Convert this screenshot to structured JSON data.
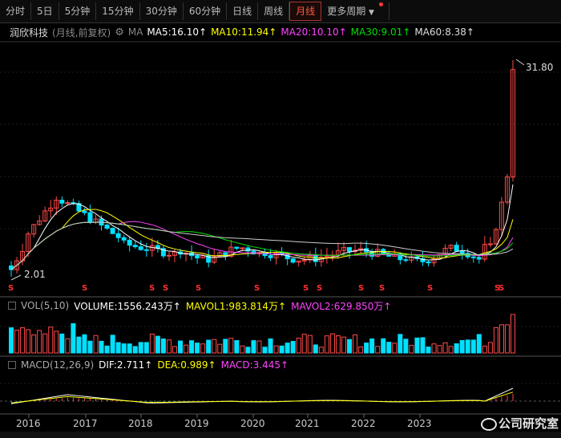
{
  "toolbar": {
    "tabs": [
      "分时",
      "5日",
      "5分钟",
      "15分钟",
      "30分钟",
      "60分钟",
      "日线",
      "周线",
      "月线",
      "更多周期"
    ],
    "active": "月线"
  },
  "info": {
    "stock_name": "润欣科技",
    "note": "(月线,前复权)",
    "ma_label": "MA",
    "ma5": "MA5:16.10↑",
    "ma10": "MA10:11.94↑",
    "ma20": "MA20:10.10↑",
    "ma30": "MA30:9.01↑",
    "ma60": "MA60:8.38↑"
  },
  "price_labels": {
    "high": "31.80",
    "low": "2.01"
  },
  "vol": {
    "title": "VOL(5,10)",
    "volume": "VOLUME:1556.243万↑",
    "mavol1": "MAVOL1:983.814万↑",
    "mavol2": "MAVOL2:629.850万↑"
  },
  "macd": {
    "title": "MACD(12,26,9)",
    "dif": "DIF:2.711↑",
    "dea": "DEA:0.989↑",
    "macd": "MACD:3.445↑"
  },
  "years": [
    "2016",
    "2017",
    "2018",
    "2019",
    "2020",
    "2021",
    "2022",
    "2023"
  ],
  "watermark": "公司研究室",
  "colors": {
    "up": "#ff4a4a",
    "down": "#00e0ff",
    "ma5": "#ffffff",
    "ma10": "#ffff00",
    "ma20": "#ff44ff",
    "ma30": "#00e000",
    "ma60": "#cccccc"
  }
}
